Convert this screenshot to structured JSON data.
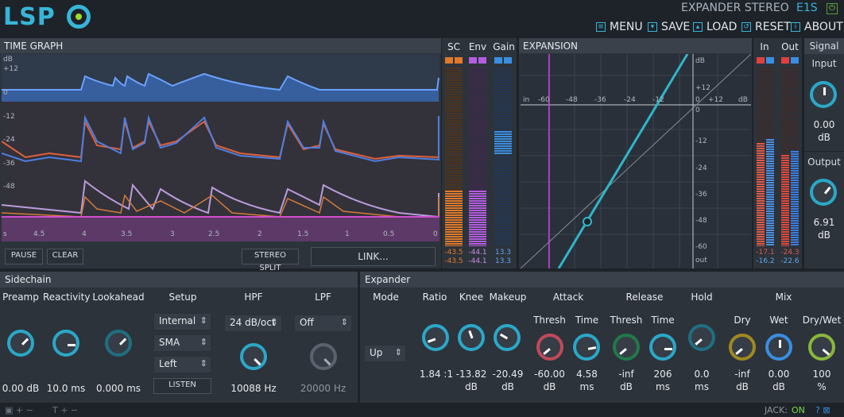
{
  "header": {
    "logo": "LSP",
    "plugin_title": "EXPANDER STEREO",
    "plugin_variant": "E1S",
    "menu": [
      {
        "icon": "menu-icon",
        "label": "MENU"
      },
      {
        "icon": "save-icon",
        "label": "SAVE"
      },
      {
        "icon": "load-icon",
        "label": "LOAD"
      },
      {
        "icon": "reset-icon",
        "label": "RESET"
      },
      {
        "icon": "about-icon",
        "label": "ABOUT"
      }
    ]
  },
  "time_graph": {
    "title": "TIME GRAPH",
    "y_labels": [
      "dB",
      "+12",
      "0",
      "-12",
      "-24",
      "-36",
      "-48"
    ],
    "x_labels": [
      "s",
      "4.5",
      "4",
      "3.5",
      "3",
      "2.5",
      "2",
      "1.5",
      "1",
      "0.5",
      "0"
    ],
    "buttons": {
      "pause": "PAUSE",
      "clear": "CLEAR",
      "stereo_split": "STEREO SPLIT",
      "link": "LINK..."
    }
  },
  "meters": {
    "sc": {
      "label": "SC",
      "values": [
        "-43.5",
        "-43.5"
      ]
    },
    "env": {
      "label": "Env",
      "values": [
        "-44.1",
        "-44.1"
      ]
    },
    "gain": {
      "label": "Gain",
      "values": [
        "13.3",
        "13.3"
      ]
    },
    "in": {
      "label": "In",
      "values": [
        "-17.1",
        "-16.2"
      ]
    },
    "out": {
      "label": "Out",
      "values": [
        "-24.3",
        "-22.6"
      ]
    }
  },
  "expansion": {
    "title": "EXPANSION",
    "x_labels": [
      "in",
      "-60",
      "-48",
      "-36",
      "-24",
      "-12",
      "0",
      "+12",
      "dB"
    ],
    "y_labels": [
      "dB",
      "+12",
      "0",
      "-12",
      "-24",
      "-36",
      "-48",
      "-60",
      "out"
    ]
  },
  "signal": {
    "title": "Signal",
    "input": {
      "label": "Input",
      "value": "0.00",
      "unit": "dB"
    },
    "output": {
      "label": "Output",
      "value": "6.91",
      "unit": "dB"
    }
  },
  "sidechain": {
    "title": "Sidechain",
    "preamp": {
      "label": "Preamp",
      "value": "0.00 dB"
    },
    "reactivity": {
      "label": "Reactivity",
      "value": "10.0 ms"
    },
    "lookahead": {
      "label": "Lookahead",
      "value": "0.000 ms"
    },
    "setup": {
      "label": "Setup",
      "source": "Internal",
      "mode": "SMA",
      "channel": "Left",
      "listen": "LISTEN"
    },
    "hpf": {
      "label": "HPF",
      "slope": "24 dB/oct",
      "value": "10088 Hz"
    },
    "lpf": {
      "label": "LPF",
      "slope": "Off",
      "value": "20000 Hz"
    }
  },
  "expander": {
    "title": "Expander",
    "mode": {
      "label": "Mode",
      "value": "Up"
    },
    "ratio": {
      "label": "Ratio",
      "value": "1.84 :1"
    },
    "knee": {
      "label": "Knee",
      "value": "-13.82",
      "unit": "dB"
    },
    "makeup": {
      "label": "Makeup",
      "value": "-20.49",
      "unit": "dB"
    },
    "attack": {
      "label": "Attack",
      "thresh_label": "Thresh",
      "thresh_value": "-60.00",
      "thresh_unit": "dB",
      "time_label": "Time",
      "time_value": "4.58",
      "time_unit": "ms"
    },
    "release": {
      "label": "Release",
      "thresh_label": "Thresh",
      "thresh_value": "-inf",
      "thresh_unit": "dB",
      "time_label": "Time",
      "time_value": "206",
      "time_unit": "ms"
    },
    "hold": {
      "label": "Hold",
      "value": "0.0",
      "unit": "ms"
    },
    "mix": {
      "label": "Mix",
      "dry_label": "Dry",
      "dry_value": "-inf",
      "dry_unit": "dB",
      "wet_label": "Wet",
      "wet_value": "0.00",
      "wet_unit": "dB",
      "drywet_label": "Dry/Wet",
      "drywet_value": "100",
      "drywet_unit": "%"
    }
  },
  "status": {
    "jack_label": "JACK:",
    "jack_state": "ON"
  },
  "colors": {
    "accent": "#37b5d8",
    "panel": "#2d333b",
    "header": "#3a414a",
    "on": "#7ad84a"
  }
}
